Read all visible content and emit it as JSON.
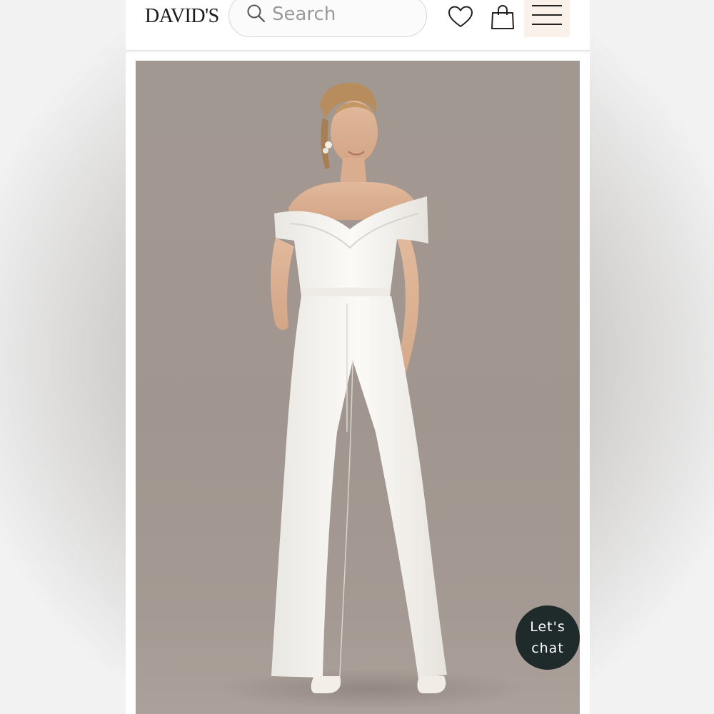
{
  "header": {
    "logo": "DAVID'S",
    "search": {
      "placeholder": "Search"
    },
    "icons": [
      "search-icon",
      "heart-icon",
      "shopping-bag-icon",
      "hamburger-menu-icon"
    ]
  },
  "hero": {
    "image_alt": "Model in white off-the-shoulder jumpsuit"
  },
  "chat": {
    "label": "Let's\nchat"
  },
  "colors": {
    "hero_background": "#a29892",
    "chat_background": "#1f2a2a",
    "menu_button_background": "#fbf1eb"
  }
}
